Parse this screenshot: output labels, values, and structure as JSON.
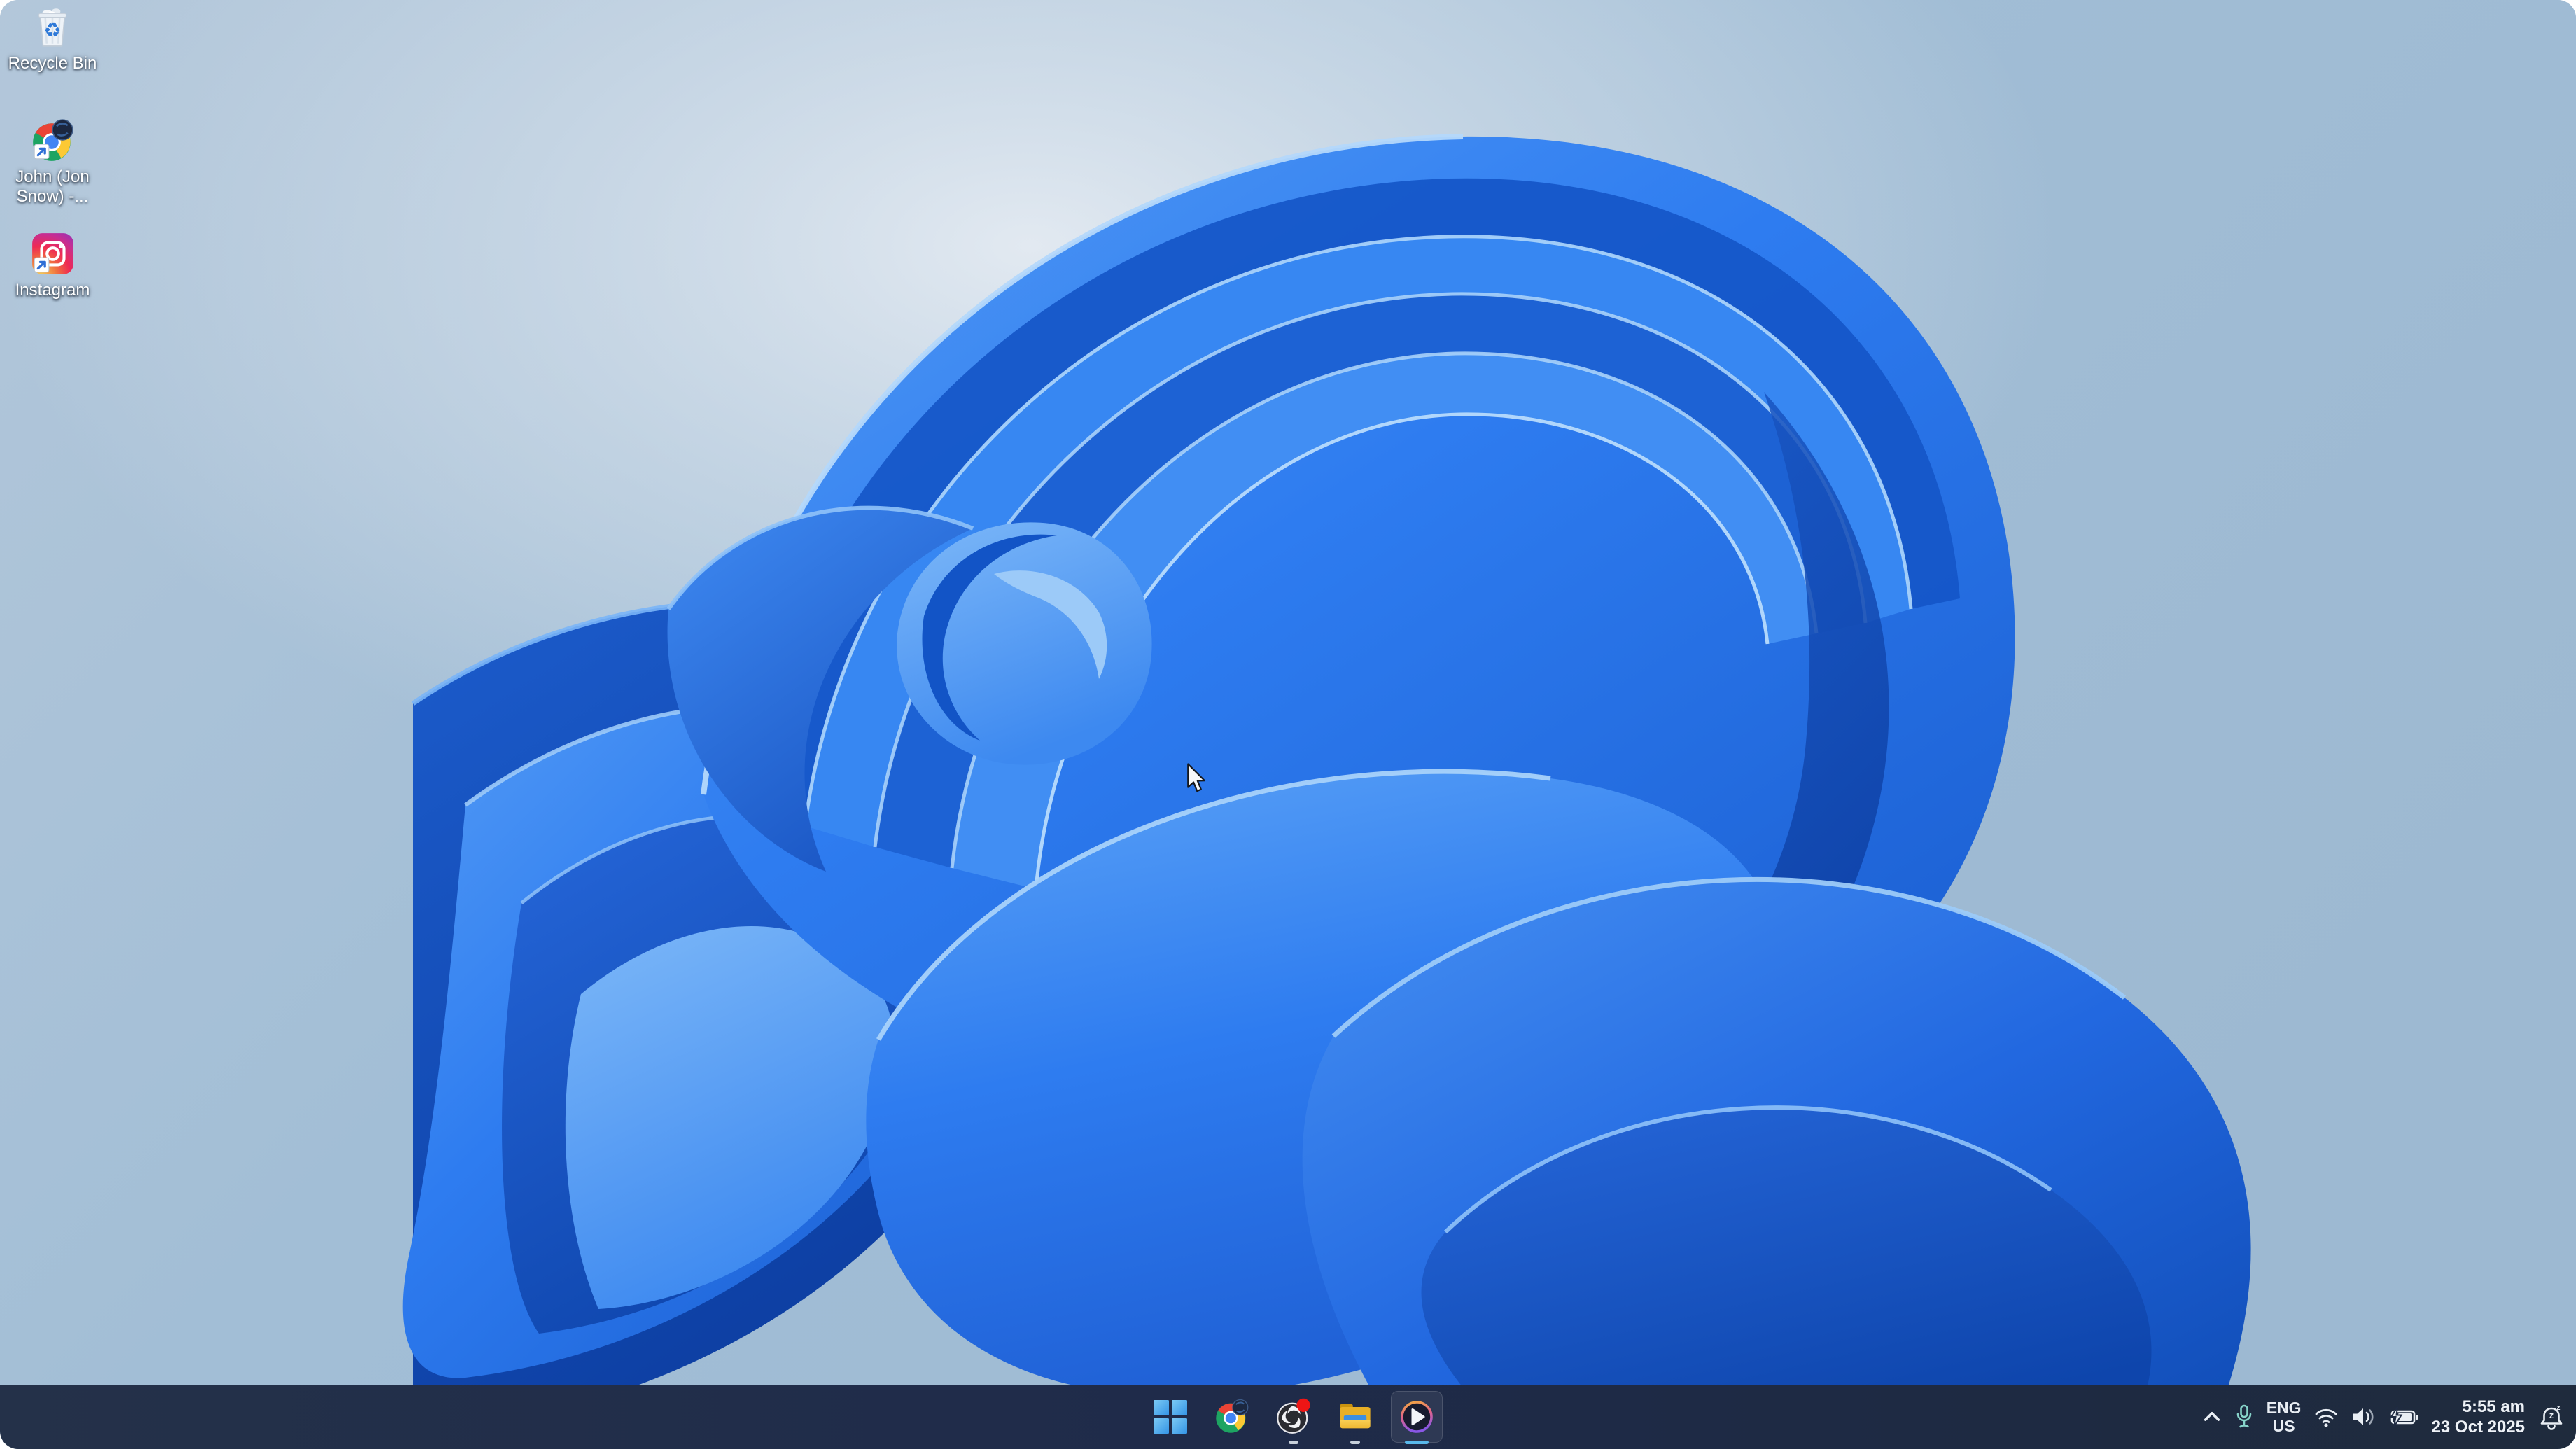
{
  "wallpaper": {
    "name": "windows-11-bloom",
    "background_color": "#9fbcd5",
    "bloom_primary_blue": "#2e7cf0",
    "bloom_deep_blue": "#0c3da0",
    "bloom_highlight_blue": "#a8d2fa"
  },
  "desktop": {
    "icons": [
      {
        "name": "recycle-bin",
        "icon": "recycle-bin-icon",
        "label": "Recycle Bin"
      },
      {
        "name": "chrome-profile-shortcut",
        "icon": "chrome-profile-icon",
        "label": "John (Jon Snow) -..."
      },
      {
        "name": "instagram-shortcut",
        "icon": "instagram-icon",
        "label": "Instagram"
      }
    ]
  },
  "taskbar": {
    "bar_color": "#202c44",
    "active_indicator_color": "#58b8eb",
    "buttons": [
      {
        "name": "start-button",
        "icon": "windows-logo-icon",
        "running": false,
        "active": false
      },
      {
        "name": "chrome-button",
        "icon": "chrome-profile-icon",
        "running": false,
        "active": false
      },
      {
        "name": "obs-studio-button",
        "icon": "obs-icon",
        "badge": "recording-red-dot",
        "running": true,
        "active": false
      },
      {
        "name": "file-explorer-button",
        "icon": "folder-icon",
        "running": true,
        "active": false
      },
      {
        "name": "media-player-button",
        "icon": "play-circle-icon",
        "running": true,
        "active": true
      }
    ],
    "tray": {
      "chevron": "show-hidden-icons",
      "microphone_color": "#87d4ca",
      "language": {
        "line1": "ENG",
        "line2": "US"
      },
      "status_icons": [
        "wifi-icon",
        "volume-icon",
        "battery-charging-icon"
      ],
      "clock": {
        "time": "5:55 am",
        "date": "23 Oct 2025"
      },
      "notification_mode": "do-not-disturb-bell"
    }
  }
}
